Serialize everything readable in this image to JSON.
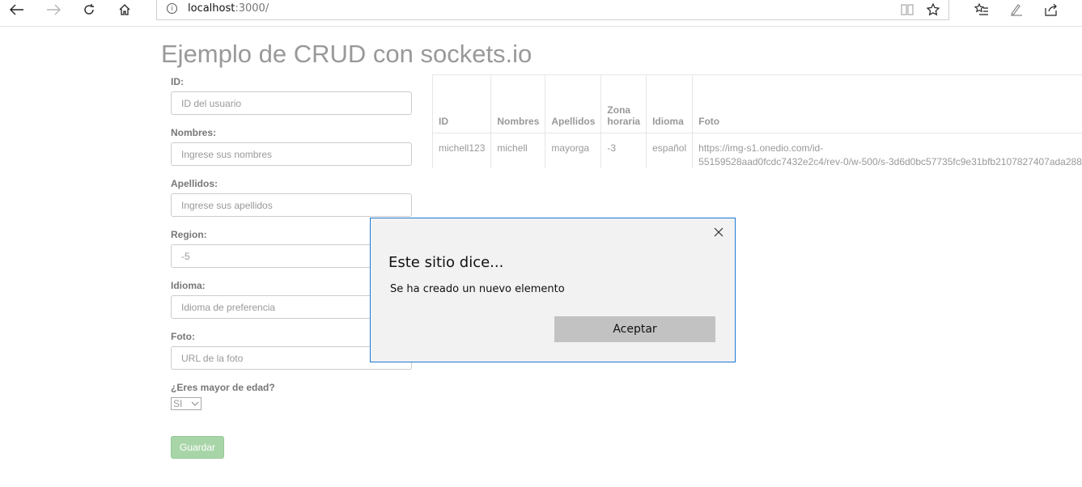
{
  "browser": {
    "address": {
      "host": "localhost",
      "port_path": ":3000/"
    },
    "icons": {
      "back": "back-arrow-icon",
      "forward": "forward-arrow-icon",
      "refresh": "refresh-icon",
      "home": "home-icon",
      "info": "info-icon",
      "reading_view": "reading-view-icon",
      "favorite": "star-icon",
      "favorites_list": "favorites-list-icon",
      "pen": "pen-icon",
      "share": "share-icon"
    }
  },
  "page": {
    "title": "Ejemplo de CRUD con sockets.io"
  },
  "form": {
    "id": {
      "label": "ID:",
      "placeholder": "ID del usuario"
    },
    "nombres": {
      "label": "Nombres:",
      "placeholder": "Ingrese sus nombres"
    },
    "apellidos": {
      "label": "Apellidos:",
      "placeholder": "Ingrese sus apellidos"
    },
    "region": {
      "label": "Region:",
      "value": "-5"
    },
    "idioma": {
      "label": "Idioma:",
      "placeholder": "Idioma de preferencia"
    },
    "foto": {
      "label": "Foto:",
      "placeholder": "URL de la foto"
    },
    "mayor": {
      "label": "¿Eres mayor de edad?",
      "selected": "SI"
    },
    "save_label": "Guardar"
  },
  "table": {
    "headers": [
      "ID",
      "Nombres",
      "Apellidos",
      "Zona horaria",
      "Idioma",
      "Foto"
    ],
    "rows": [
      {
        "id": "michell123",
        "nombres": "michell",
        "apellidos": "mayorga",
        "zona": "-3",
        "idioma": "español",
        "foto_line1": "https://img-s1.onedio.com/id-",
        "foto_line2": "55159528aad0fcdc7432e2c4/rev-0/w-500/s-3d6d0bc57735fc9e31bfb2107827407ada288"
      }
    ]
  },
  "dialog": {
    "title": "Este sitio dice...",
    "message": "Se ha creado un nuevo elemento",
    "ok_label": "Aceptar"
  }
}
